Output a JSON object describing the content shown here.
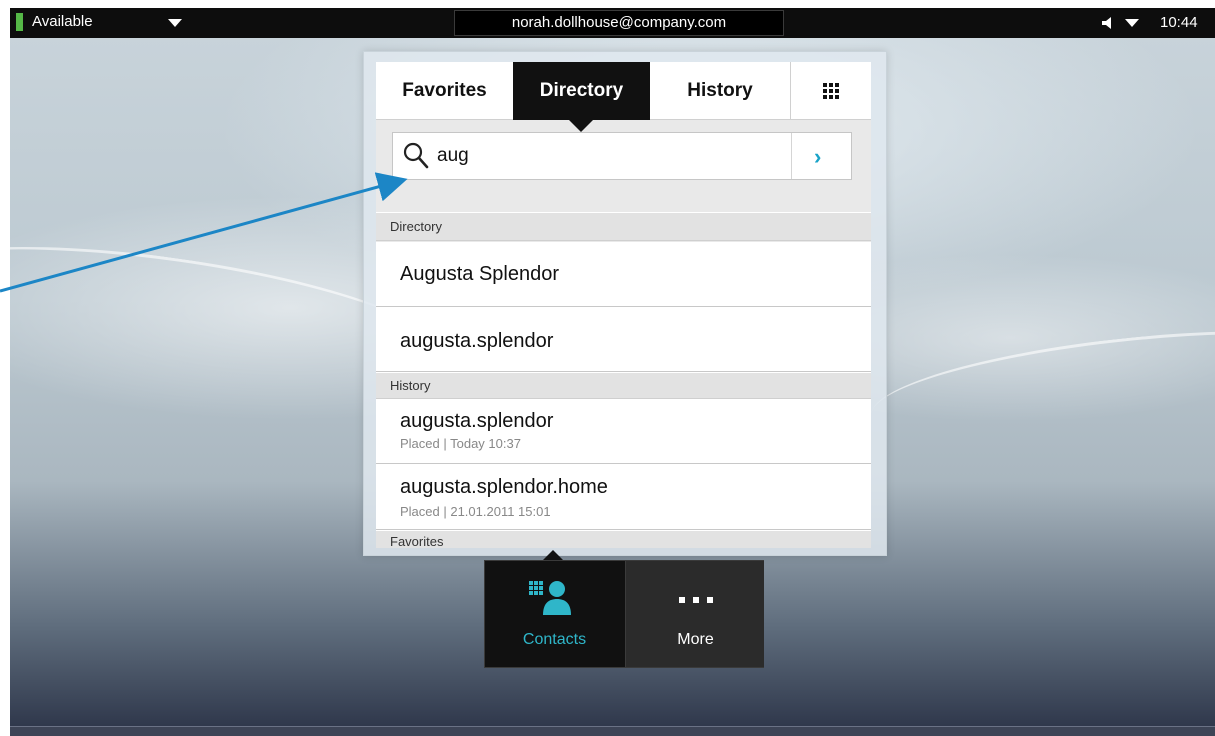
{
  "status_bar": {
    "availability": "Available",
    "account": "norah.dollhouse@company.com",
    "time": "10:44"
  },
  "tabs": [
    {
      "label": "Favorites"
    },
    {
      "label": "Directory"
    },
    {
      "label": "History"
    }
  ],
  "search": {
    "value": "aug"
  },
  "sections": {
    "directory": "Directory",
    "history": "History",
    "favorites": "Favorites"
  },
  "directory_results": [
    {
      "name": "Augusta Splendor"
    },
    {
      "name": "augusta.splendor"
    }
  ],
  "history_results": [
    {
      "name": "augusta.splendor",
      "detail": "Placed | Today 10:37"
    },
    {
      "name": "augusta.splendor.home",
      "detail": "Placed | 21.01.2011 15:01"
    }
  ],
  "dock": {
    "contacts_label": "Contacts",
    "more_label": "More"
  },
  "colors": {
    "accent": "#1aa3c8",
    "status_available": "#55b847",
    "annotation_arrow": "#1c86c6"
  },
  "icons": [
    "status-caret-icon",
    "volume-icon",
    "keypad-grid-icon",
    "search-icon",
    "chevron-right-icon",
    "contacts-icon",
    "more-dots-icon"
  ]
}
